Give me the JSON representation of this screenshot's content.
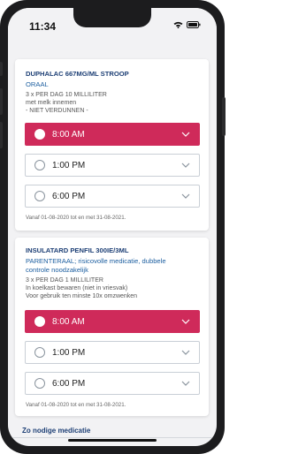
{
  "status": {
    "time": "11:34"
  },
  "medications": [
    {
      "name": "DUPHALAC 667MG/ML STROOP",
      "route": "ORAAL",
      "dosage_lines": [
        "3 x PER DAG 10 MILLILITER",
        "met melk innemen",
        "- NIET VERDUNNEN -"
      ],
      "slots": [
        {
          "time": "8:00 AM",
          "selected": true
        },
        {
          "time": "1:00 PM",
          "selected": false
        },
        {
          "time": "6:00 PM",
          "selected": false
        }
      ],
      "period": "Vanaf 01-08-2020 tot en met 31-08-2021."
    },
    {
      "name": "INSULATARD PENFIL 300IE/3ML",
      "route_lines": [
        "PARENTERAAL; risicovolle medicatie, dubbele",
        "controle noodzakelijk"
      ],
      "dosage_lines": [
        "3 x PER DAG 1 MILLILITER",
        "In koelkast bewaren (niet in vriesvak)",
        "Voor gebruik ten minste 10x omzwenken"
      ],
      "slots": [
        {
          "time": "8:00 AM",
          "selected": true
        },
        {
          "time": "1:00 PM",
          "selected": false
        },
        {
          "time": "6:00 PM",
          "selected": false
        }
      ],
      "period": "Vanaf 01-08-2020 tot en met 31-08-2021."
    }
  ],
  "section": {
    "title": "Zo nodige medicatie"
  },
  "colors": {
    "accent": "#cf2a5a",
    "heading": "#1d3f75",
    "link": "#1d5fa0"
  }
}
